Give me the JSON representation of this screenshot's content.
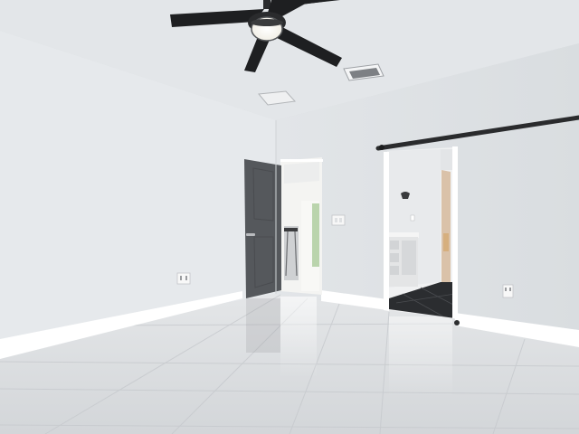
{
  "scene": {
    "subject": "empty-bedroom-interior",
    "colors": {
      "ceiling": "#e3e6e9",
      "left_wall": "#e6e9ec",
      "back_wall": "#e1e4e7",
      "baseboard": "#ffffff",
      "floor": "#dcdee1",
      "door": "#55585c",
      "fan": "#1e1f21",
      "barn_rail": "#2a2b2d",
      "dark_tile": "#2b2d30"
    },
    "elements": [
      "ceiling-fan-icon",
      "air-vent-icon",
      "open-door-icon",
      "barn-door-rail-icon",
      "bathroom-vanity-icon",
      "wall-outlet-icon",
      "light-switch-icon"
    ]
  }
}
